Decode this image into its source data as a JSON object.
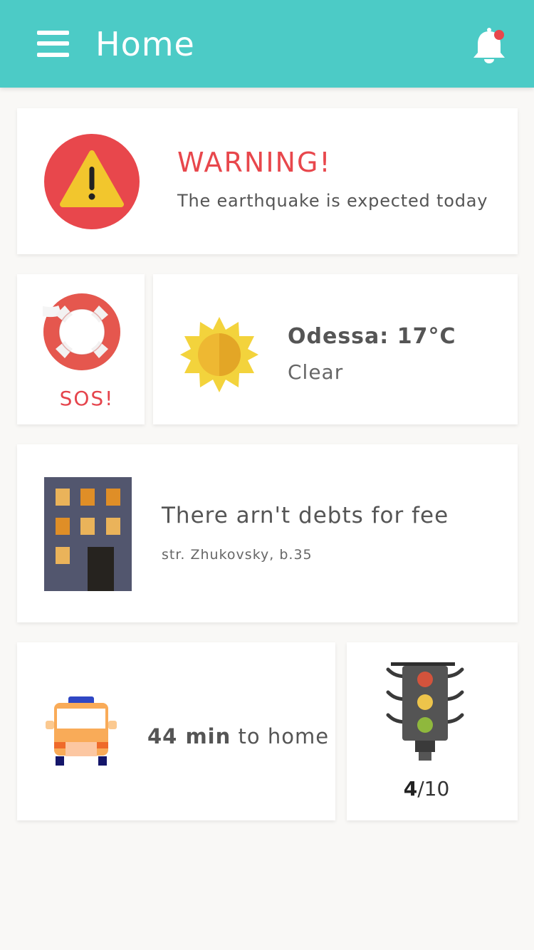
{
  "appbar": {
    "title": "Home",
    "menu_icon": "hamburger-menu-icon",
    "bell_icon": "notification-bell-icon",
    "background_color": "#4ccbc6",
    "has_unread_notification": true
  },
  "warning": {
    "icon": "warning-triangle-icon",
    "title": "WARNING!",
    "message": "The earthquake is expected today",
    "accent_color": "#e8474c"
  },
  "sos": {
    "icon": "lifebuoy-icon",
    "label": "SOS!"
  },
  "weather": {
    "icon": "sun-icon",
    "city_temp": "Odessa: 17°C",
    "condition": "Clear"
  },
  "house": {
    "icon": "apartment-building-icon",
    "title": "There arn't debts for fee",
    "address": "str. Zhukovsky, b.35"
  },
  "route": {
    "icon": "taxi-car-icon",
    "time": "44 min",
    "suffix": "to home"
  },
  "traffic": {
    "icon": "traffic-light-icon",
    "score": "4",
    "max": "/10"
  }
}
